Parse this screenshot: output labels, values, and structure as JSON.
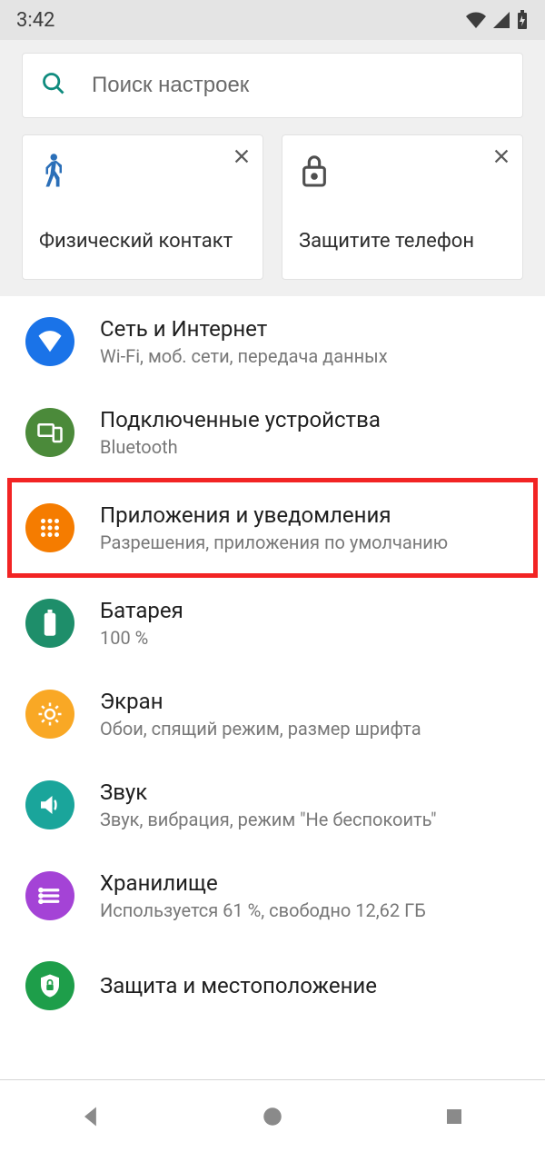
{
  "status": {
    "time": "3:42"
  },
  "search": {
    "placeholder": "Поиск настроек"
  },
  "cards": [
    {
      "title": "Физический контакт"
    },
    {
      "title": "Защитите телефон"
    }
  ],
  "settings": [
    {
      "key": "network",
      "title": "Сеть и Интернет",
      "sub": "Wi-Fi, моб. сети, передача данных",
      "iconClass": "ic-network",
      "highlight": false
    },
    {
      "key": "devices",
      "title": "Подключенные устройства",
      "sub": "Bluetooth",
      "iconClass": "ic-devices",
      "highlight": false
    },
    {
      "key": "apps",
      "title": "Приложения и уведомления",
      "sub": "Разрешения, приложения по умолчанию",
      "iconClass": "ic-apps",
      "highlight": true
    },
    {
      "key": "battery",
      "title": "Батарея",
      "sub": "100 %",
      "iconClass": "ic-battery",
      "highlight": false
    },
    {
      "key": "display",
      "title": "Экран",
      "sub": "Обои, спящий режим, размер шрифта",
      "iconClass": "ic-display",
      "highlight": false
    },
    {
      "key": "sound",
      "title": "Звук",
      "sub": "Звук, вибрация, режим \"Не беспокоить\"",
      "iconClass": "ic-sound",
      "highlight": false
    },
    {
      "key": "storage",
      "title": "Хранилище",
      "sub": "Используется 61 %, свободно 12,62 ГБ",
      "iconClass": "ic-storage",
      "highlight": false
    },
    {
      "key": "security",
      "title": "Защита и местоположение",
      "sub": "",
      "iconClass": "ic-security",
      "highlight": false
    }
  ]
}
